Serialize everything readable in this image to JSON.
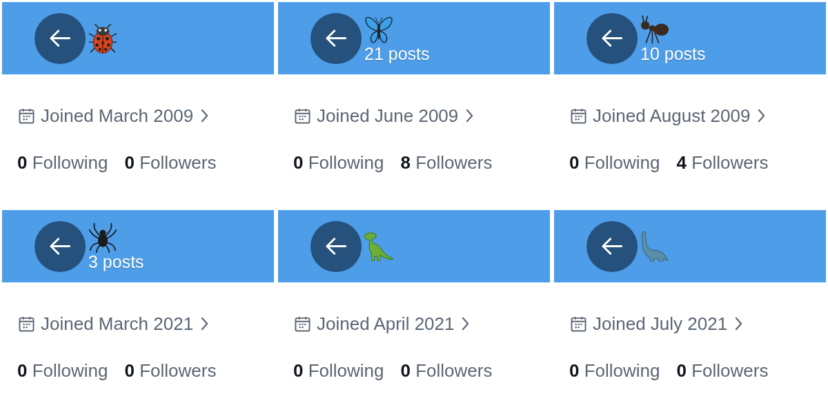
{
  "profiles": [
    {
      "kind": "ladybug",
      "joined": "Joined March 2009",
      "following": "**0** Following",
      "followers": "**0** Followers"
    },
    {
      "kind": "butterfly",
      "posts": "21 posts",
      "joined": "Joined June 2009",
      "following": "**0** Following",
      "followers": "**8** Followers"
    },
    {
      "kind": "ant",
      "posts": "10 posts",
      "joined": "Joined August 2009",
      "following": "**0** Following",
      "followers": "**4** Followers"
    },
    {
      "kind": "spider",
      "posts": "3 posts",
      "joined": "Joined March 2021",
      "following": "**0** Following",
      "followers": "**0** Followers"
    },
    {
      "kind": "trex",
      "joined": "Joined April 2021",
      "following": "**0** Following",
      "followers": "**0** Followers"
    },
    {
      "kind": "sauropod",
      "joined": "Joined July 2021",
      "following": "**0** Following",
      "followers": "**0** Followers"
    }
  ]
}
